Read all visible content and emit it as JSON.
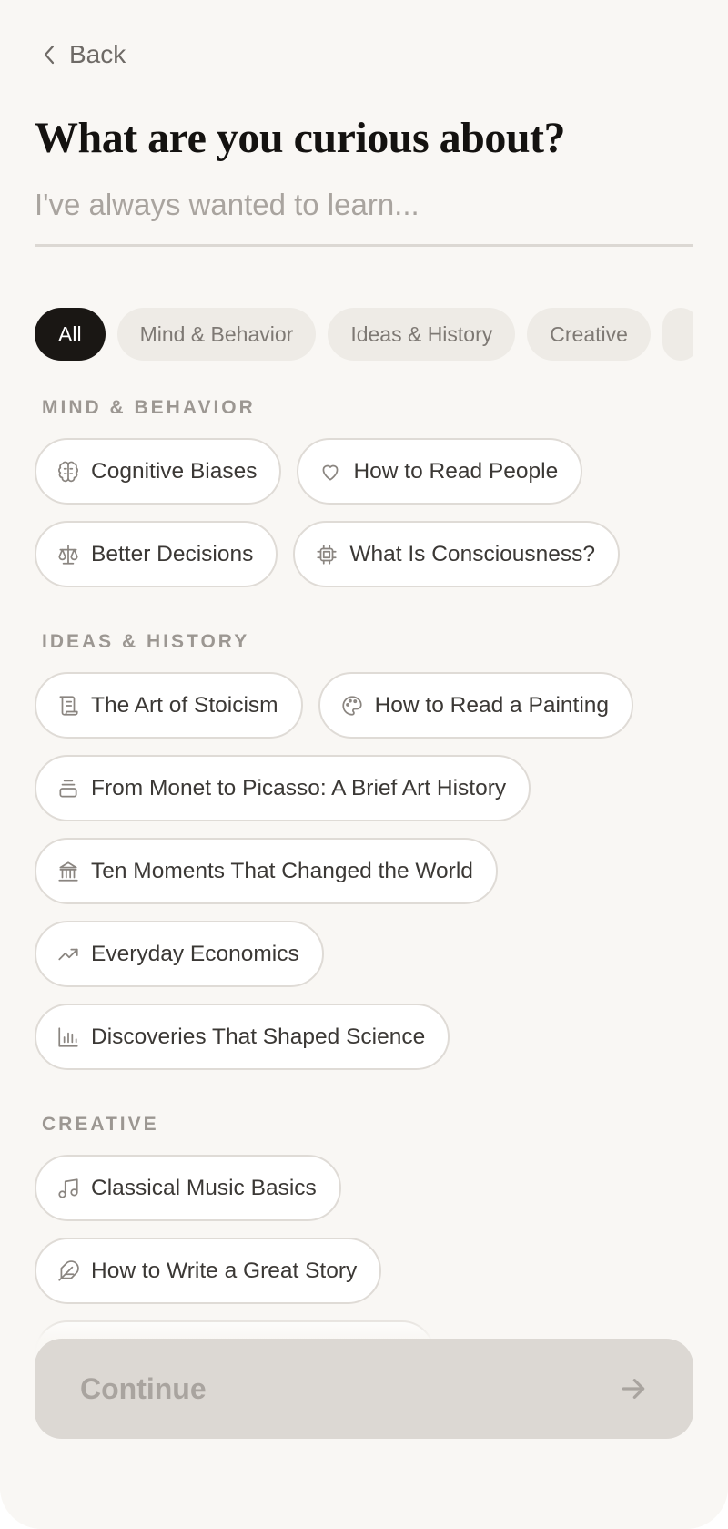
{
  "header": {
    "back_label": "Back",
    "title": "What are you curious about?"
  },
  "search": {
    "placeholder": "I've always wanted to learn..."
  },
  "filters": [
    {
      "label": "All",
      "active": true
    },
    {
      "label": "Mind & Behavior",
      "active": false
    },
    {
      "label": "Ideas & History",
      "active": false
    },
    {
      "label": "Creative",
      "active": false
    }
  ],
  "sections": [
    {
      "label": "MIND & BEHAVIOR",
      "topics": [
        {
          "label": "Cognitive Biases",
          "icon": "brain-icon"
        },
        {
          "label": "How to Read People",
          "icon": "heart-icon"
        },
        {
          "label": "Better Decisions",
          "icon": "scale-icon"
        },
        {
          "label": "What Is Consciousness?",
          "icon": "chip-icon"
        }
      ]
    },
    {
      "label": "IDEAS & HISTORY",
      "topics": [
        {
          "label": "The Art of Stoicism",
          "icon": "scroll-icon"
        },
        {
          "label": "How to Read a Painting",
          "icon": "palette-icon"
        },
        {
          "label": "From Monet to Picasso: A Brief Art History",
          "icon": "layers-icon"
        },
        {
          "label": "Ten Moments That Changed the World",
          "icon": "landmark-icon"
        },
        {
          "label": "Everyday Economics",
          "icon": "trending-up-icon"
        },
        {
          "label": "Discoveries That Shaped Science",
          "icon": "bar-chart-icon"
        }
      ]
    },
    {
      "label": "CREATIVE",
      "topics": [
        {
          "label": "Classical Music Basics",
          "icon": "music-note-icon"
        },
        {
          "label": "How to Write a Great Story",
          "icon": "feather-icon"
        }
      ]
    }
  ],
  "footer": {
    "continue_label": "Continue"
  }
}
